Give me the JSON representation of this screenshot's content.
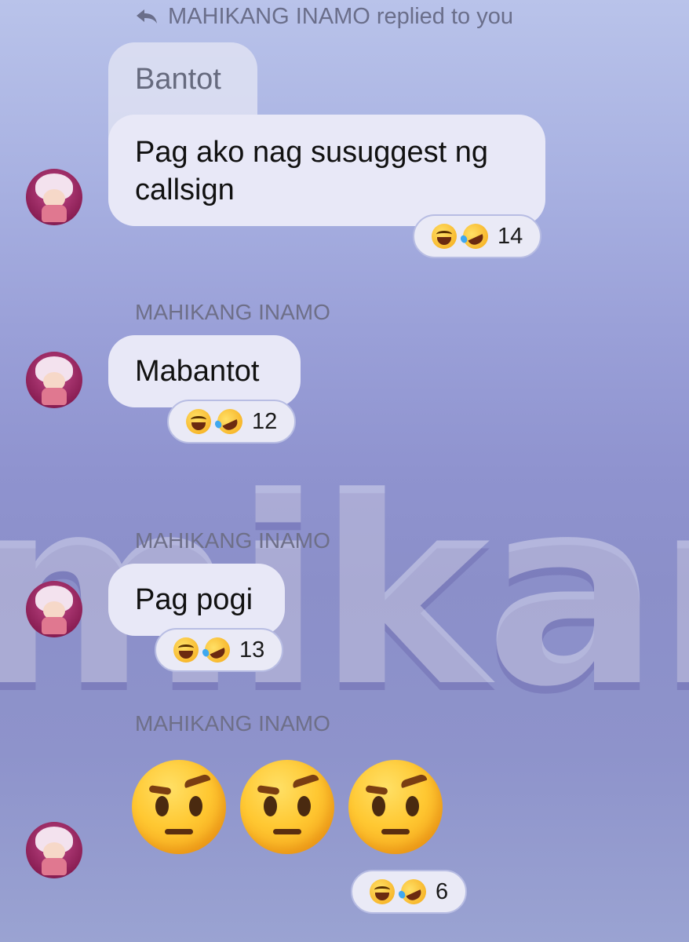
{
  "reply_header": {
    "text": "MAHIKANG INAMO replied to you"
  },
  "quoted": {
    "text": "Bantot"
  },
  "messages": [
    {
      "sender": "",
      "text": "Pag ako nag susuggest ng callsign",
      "reaction_count": "14"
    },
    {
      "sender": "MAHIKANG INAMO",
      "text": "Mabantot",
      "reaction_count": "12"
    },
    {
      "sender": "MAHIKANG INAMO",
      "text": "Pag pogi",
      "reaction_count": "13"
    },
    {
      "sender": "MAHIKANG INAMO",
      "text": "",
      "emoji": [
        "face-with-raised-eyebrow",
        "face-with-raised-eyebrow",
        "face-with-raised-eyebrow"
      ],
      "reaction_count": "6"
    }
  ],
  "reactions_icons": [
    "grinning-squinting-face",
    "rolling-on-floor-laughing"
  ],
  "background_text": "mikanis",
  "colors": {
    "bubble": "#e8e8f7",
    "reaction_border": "#b8bde3",
    "avatar": "#8b1f55"
  }
}
